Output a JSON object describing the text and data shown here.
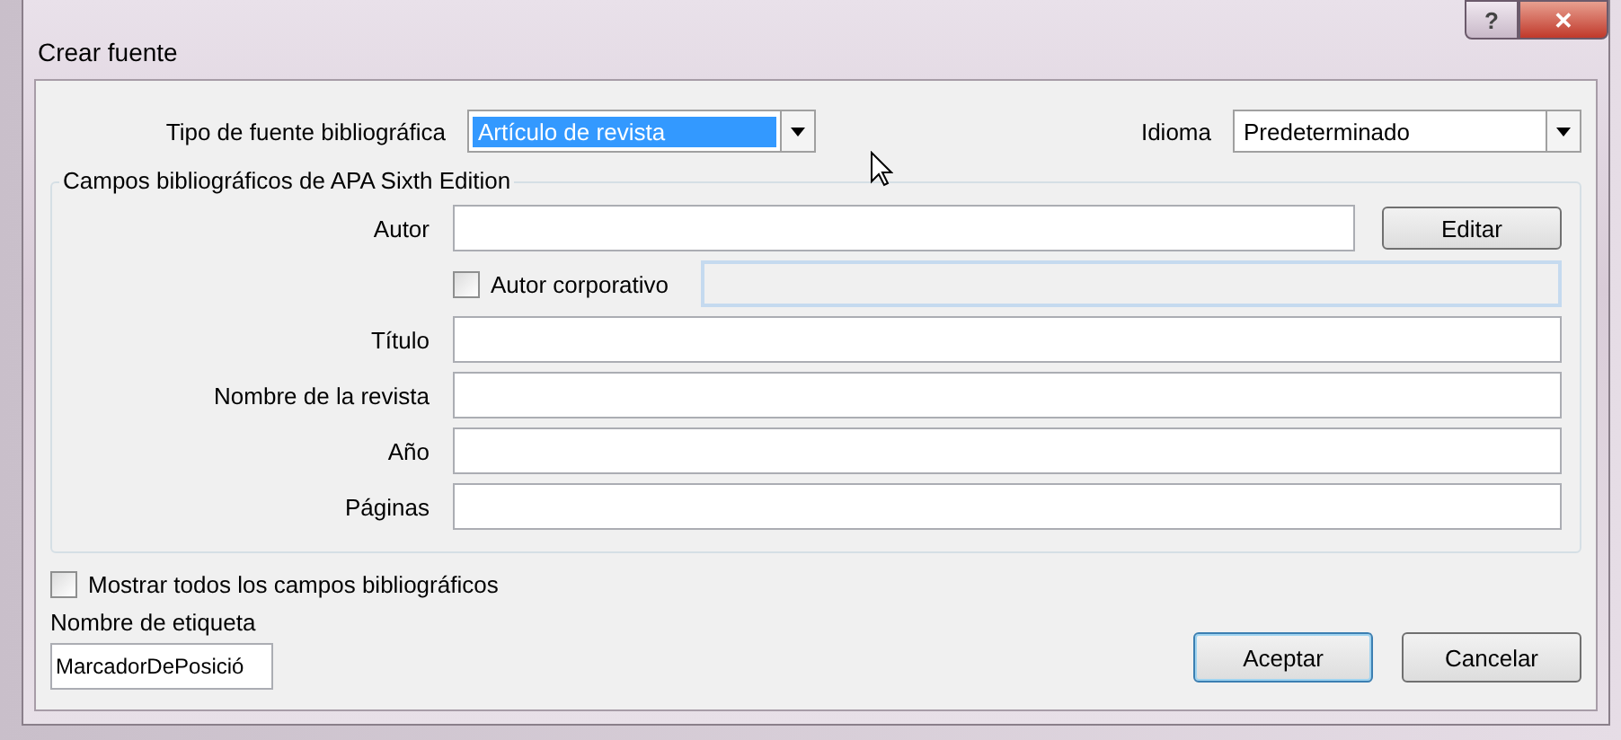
{
  "window": {
    "title": "Crear fuente",
    "help_button": "?",
    "close_button": "✕"
  },
  "source_type": {
    "label": "Tipo de fuente bibliográfica",
    "value": "Artículo de revista",
    "focused": true
  },
  "language": {
    "label": "Idioma",
    "value": "Predeterminado"
  },
  "group": {
    "title": "Campos bibliográficos de APA Sixth Edition",
    "rows": [
      {
        "kind": "field_button",
        "label": "Autor",
        "button": "Editar"
      },
      {
        "kind": "checkbox_field",
        "label": "Autor corporativo",
        "checked": false,
        "disabled": true
      },
      {
        "kind": "field",
        "label": "Título"
      },
      {
        "kind": "field",
        "label": "Nombre de la revista"
      },
      {
        "kind": "field",
        "label": "Año"
      },
      {
        "kind": "field",
        "label": "Páginas"
      }
    ]
  },
  "show_all": {
    "label": "Mostrar todos los campos bibliográficos",
    "checked": false
  },
  "tag_name": {
    "label": "Nombre de etiqueta",
    "value": "MarcadorDePosició"
  },
  "buttons": [
    {
      "label": "Aceptar",
      "default": true
    },
    {
      "label": "Cancelar",
      "default": false
    }
  ]
}
